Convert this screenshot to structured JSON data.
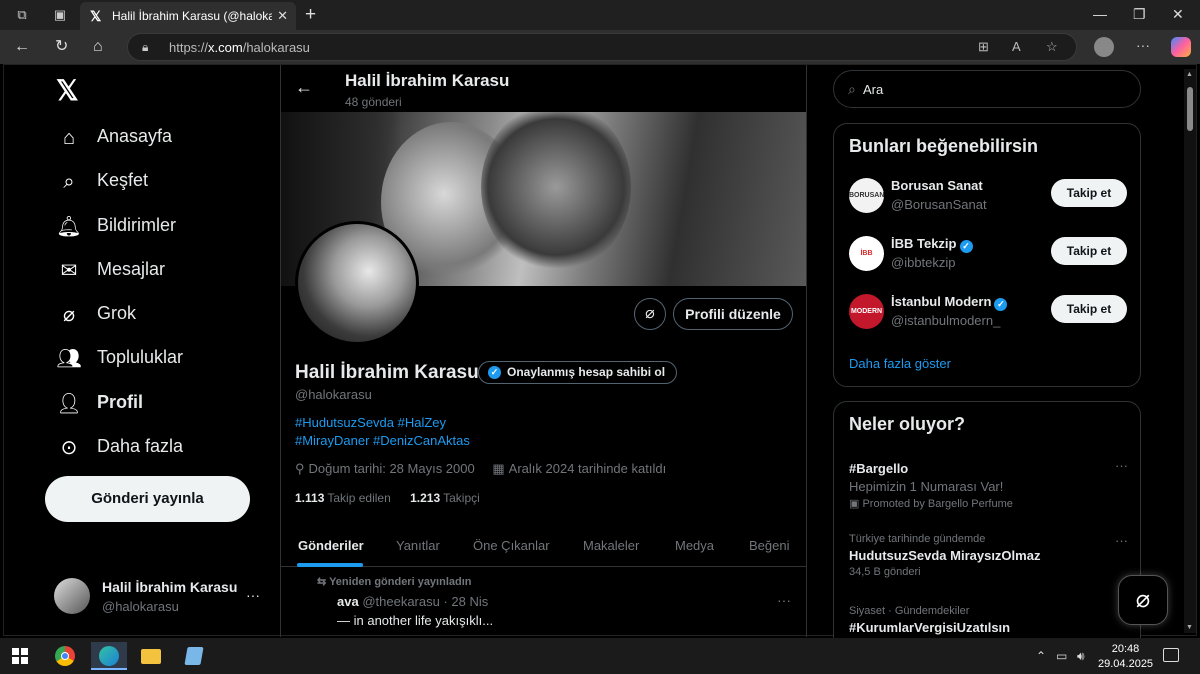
{
  "browser": {
    "tab_title": "Halil İbrahim Karasu (@halokarasu) / X",
    "url_prefix": "https://",
    "url_domain": "x.com",
    "url_path": "/halokarasu"
  },
  "nav": {
    "items": [
      {
        "label": "Anasayfa",
        "icon": "home-icon"
      },
      {
        "label": "Keşfet",
        "icon": "search-icon"
      },
      {
        "label": "Bildirimler",
        "icon": "bell-icon"
      },
      {
        "label": "Mesajlar",
        "icon": "mail-icon"
      },
      {
        "label": "Grok",
        "icon": "grok-icon"
      },
      {
        "label": "Topluluklar",
        "icon": "people-icon"
      },
      {
        "label": "Profil",
        "icon": "person-icon"
      },
      {
        "label": "Daha fazla",
        "icon": "more-circle-icon"
      }
    ],
    "post_button": "Gönderi yayınla",
    "account_name": "Halil İbrahim Karasu",
    "account_handle": "@halokarasu"
  },
  "profile": {
    "header_name": "Halil İbrahim Karasu",
    "post_count": "48 gönderi",
    "edit_button": "Profili düzenle",
    "name": "Halil İbrahim Karasu",
    "verify_pill": "Onaylanmış hesap sahibi ol",
    "handle": "@halokarasu",
    "bio_line1": "#HudutsuzSevda #HalZey",
    "bio_line2": "#MirayDaner #DenizCanAktas",
    "birthday": "Doğum tarihi: 28 Mayıs 2000",
    "joined": "Aralık 2024 tarihinde katıldı",
    "following_count": "1.113",
    "following_label": "Takip edilen",
    "followers_count": "1.213",
    "followers_label": "Takipçi"
  },
  "tabs": [
    "Gönderiler",
    "Yanıtlar",
    "Öne Çıkanlar",
    "Makaleler",
    "Medya",
    "Beğeni"
  ],
  "tweet": {
    "repost_label": "Yeniden gönderi yayınladın",
    "author": "ava",
    "meta": "@theekarasu · 28 Nis",
    "text": "— in another life yakışıklı..."
  },
  "search": {
    "placeholder": "Ara"
  },
  "who_to_follow": {
    "title": "Bunları beğenebilirsin",
    "items": [
      {
        "name": "Borusan Sanat",
        "handle": "@BorusanSanat",
        "verified": false,
        "button": "Takip et"
      },
      {
        "name": "İBB Tekzip",
        "handle": "@ibbtekzip",
        "verified": true,
        "button": "Takip et"
      },
      {
        "name": "İstanbul Modern",
        "handle": "@istanbulmodern_",
        "verified": true,
        "button": "Takip et"
      }
    ],
    "show_more": "Daha fazla göster"
  },
  "trends": {
    "title": "Neler oluyor?",
    "items": [
      {
        "tag": "#Bargello",
        "desc": "Hepimizin 1 Numarası Var!",
        "promo": "Promoted by Bargello Perfume"
      },
      {
        "context": "Türkiye tarihinde gündemde",
        "tag": "HudutsuzSevda MiraysızOlmaz",
        "count": "34,5 B gönderi"
      },
      {
        "context": "Siyaset · Gündemdekiler",
        "tag": "#KurumlarVergisiUzatılsın"
      }
    ]
  },
  "taskbar": {
    "time": "20:48",
    "date": "29.04.2025"
  },
  "colors": {
    "accent": "#1d9bf0",
    "background": "#000000"
  }
}
